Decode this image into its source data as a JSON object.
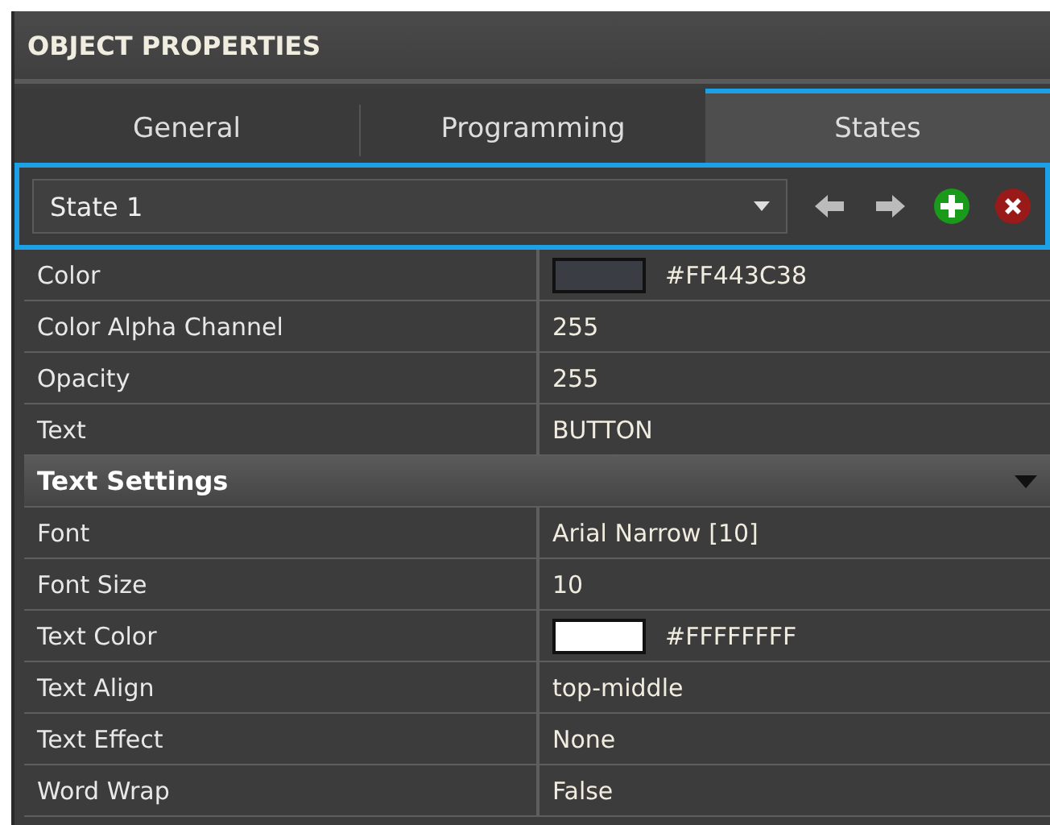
{
  "panel": {
    "title": "OBJECT PROPERTIES"
  },
  "tabs": [
    {
      "label": "General",
      "selected": false
    },
    {
      "label": "Programming",
      "selected": false
    },
    {
      "label": "States",
      "selected": true
    }
  ],
  "state_selector": {
    "value": "State 1"
  },
  "properties": [
    {
      "kind": "row",
      "name": "Color",
      "value": "#FF443C38",
      "color": "#3a3d44"
    },
    {
      "kind": "row",
      "name": "Color Alpha Channel",
      "value": "255"
    },
    {
      "kind": "row",
      "name": "Opacity",
      "value": "255"
    },
    {
      "kind": "row",
      "name": "Text",
      "value": "BUTTON"
    },
    {
      "kind": "section",
      "name": "Text Settings",
      "expanded": true
    },
    {
      "kind": "row",
      "name": "Font",
      "value": "Arial Narrow [10]"
    },
    {
      "kind": "row",
      "name": "Font Size",
      "value": "10"
    },
    {
      "kind": "row",
      "name": "Text Color",
      "value": "#FFFFFFFF",
      "color": "#ffffff"
    },
    {
      "kind": "row",
      "name": "Text Align",
      "value": "top-middle"
    },
    {
      "kind": "row",
      "name": "Text Effect",
      "value": "None"
    },
    {
      "kind": "row",
      "name": "Word Wrap",
      "value": "False"
    }
  ]
}
